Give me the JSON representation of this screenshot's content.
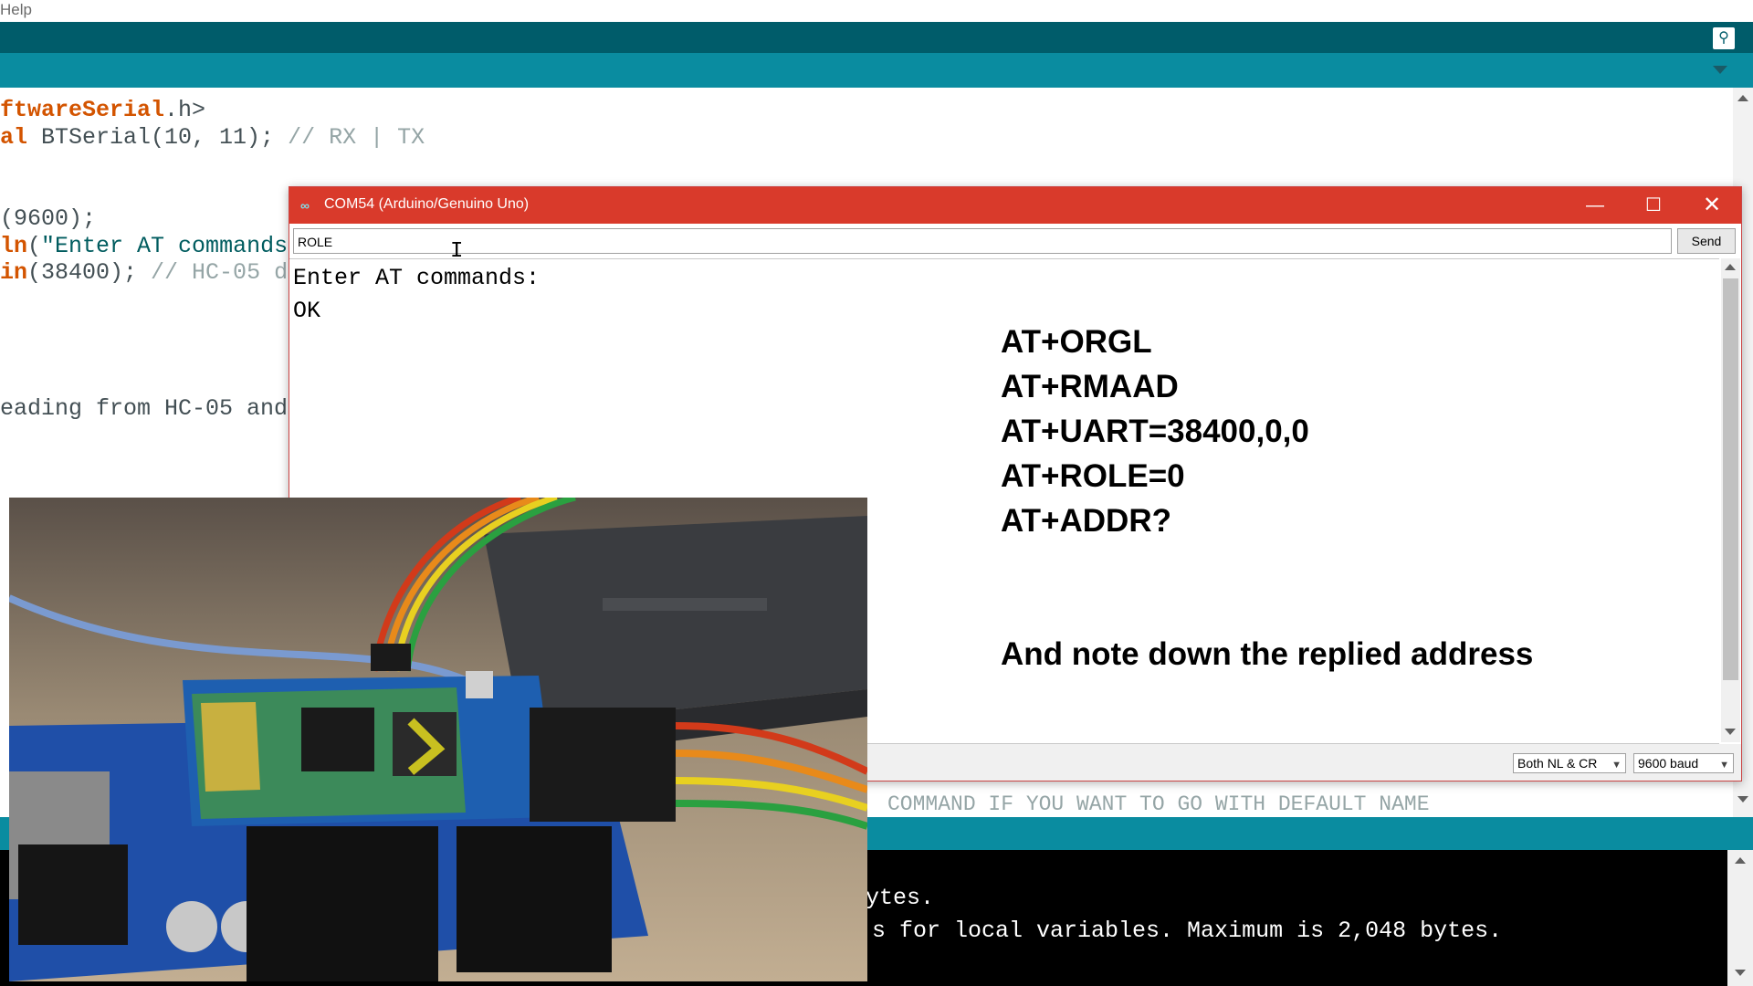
{
  "menubar": {
    "help_label": "Help"
  },
  "editor": {
    "lines": [
      {
        "kw": "ftwareSerial",
        "rest": ".h>"
      },
      {
        "kw": "al",
        "rest": " BTSerial(10, 11); ",
        "cm": "// RX | TX"
      },
      {
        "rest": "(9600);"
      },
      {
        "kw": "ln",
        "rest": "(",
        "str": "\"Enter AT commands"
      },
      {
        "kw": "in",
        "rest": "(38400); ",
        "cm": "// HC-05 d"
      },
      {
        "rest": "eading from HC-05 and"
      }
    ],
    "comment_tail": "COMMAND IF YOU WANT TO GO WITH DEFAULT NAME"
  },
  "console": {
    "line1": "ytes.",
    "line2": "s for local variables. Maximum is 2,048 bytes."
  },
  "serial_monitor": {
    "title": "COM54 (Arduino/Genuino Uno)",
    "input_value": "ROLE",
    "send_label": "Send",
    "output_lines": [
      "Enter AT commands:",
      "OK"
    ],
    "line_ending": "Both NL & CR",
    "baud": "9600 baud"
  },
  "overlay": {
    "commands": [
      "AT+ORGL",
      "AT+RMAAD",
      "AT+UART=38400,0,0",
      "AT+ROLE=0",
      "AT+ADDR?"
    ],
    "note": "And note down the replied address"
  },
  "colors": {
    "toolbar": "#005c6a",
    "tabbar": "#0a8ca0",
    "serial_titlebar": "#d93a2b"
  }
}
